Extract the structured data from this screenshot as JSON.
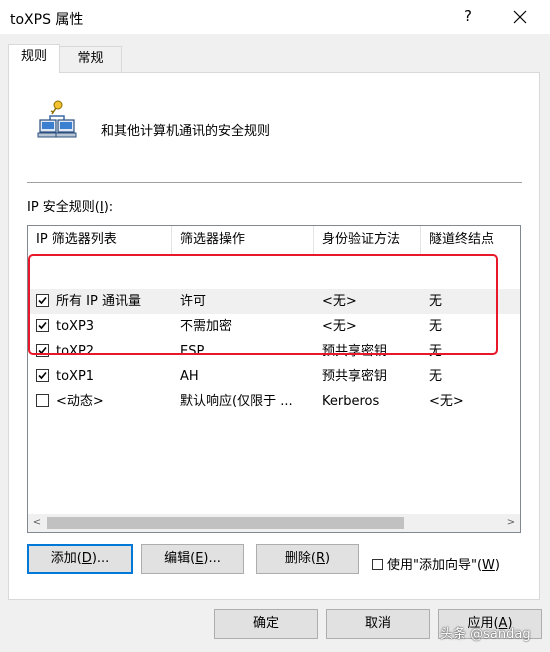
{
  "window": {
    "title": "toXPS 属性",
    "help_label": "?"
  },
  "tabs": [
    {
      "label": "规则"
    },
    {
      "label": "常规"
    }
  ],
  "header": {
    "description": "和其他计算机通讯的安全规则"
  },
  "list": {
    "label_prefix": "IP 安全规则(",
    "label_key": "I",
    "label_suffix": "):",
    "columns": [
      "IP 筛选器列表",
      "筛选器操作",
      "身份验证方法",
      "隧道终结点"
    ],
    "rows": [
      {
        "checked": true,
        "filter_list": "所有 IP 通讯量",
        "action": "许可",
        "auth": "<无>",
        "tunnel": "无"
      },
      {
        "checked": true,
        "filter_list": "toXP3",
        "action": "不需加密",
        "auth": "<无>",
        "tunnel": "无"
      },
      {
        "checked": true,
        "filter_list": "toXP2",
        "action": "ESP",
        "auth": "预共享密钥",
        "tunnel": "无"
      },
      {
        "checked": true,
        "filter_list": "toXP1",
        "action": "AH",
        "auth": "预共享密钥",
        "tunnel": "无"
      },
      {
        "checked": false,
        "filter_list": "<动态>",
        "action": "默认响应(仅限于 ...",
        "auth": "Kerberos",
        "tunnel": "<无>"
      }
    ],
    "scroll_left": "<",
    "scroll_right": ">"
  },
  "buttons": {
    "add": {
      "text": "添加(",
      "key": "D",
      "tail": ")..."
    },
    "edit": {
      "text": "编辑(",
      "key": "E",
      "tail": ")..."
    },
    "remove": {
      "text": "删除(",
      "key": "R",
      "tail": ")"
    },
    "wizard": {
      "text": "使用\"添加向导\"(",
      "key": "W",
      "tail": ")",
      "checked": false
    }
  },
  "footer": {
    "ok": "确定",
    "cancel": "取消",
    "apply_text": "应用(",
    "apply_key": "A",
    "apply_tail": ")"
  },
  "watermark": "头条 @sandag",
  "colors": {
    "highlight": "#e8182a",
    "default_button_border": "#0078d7"
  }
}
